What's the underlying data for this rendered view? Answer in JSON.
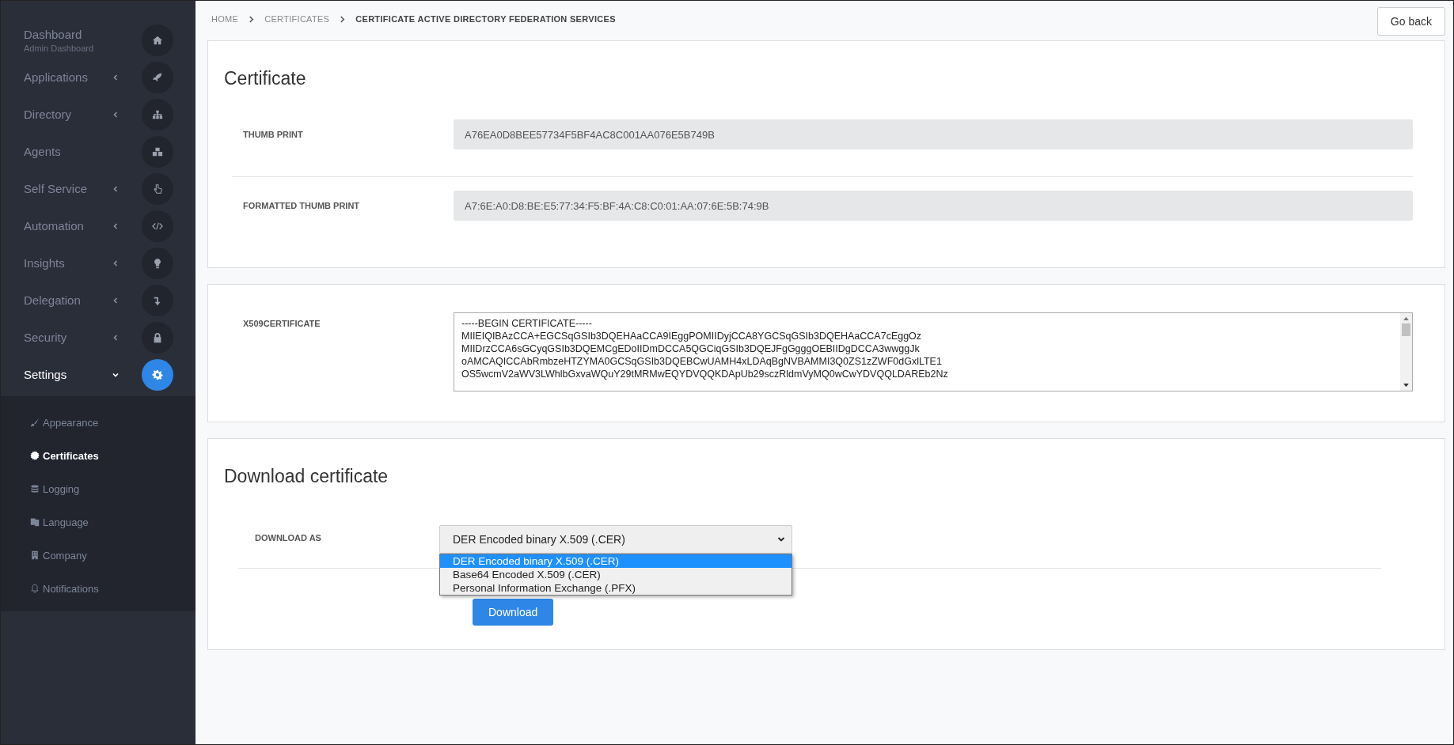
{
  "sidebar": {
    "items": [
      {
        "label": "Dashboard",
        "subtitle": "Admin Dashboard",
        "selected": false
      },
      {
        "label": "Applications",
        "expanded": false,
        "selected": false
      },
      {
        "label": "Directory",
        "expanded": false,
        "selected": false
      },
      {
        "label": "Agents",
        "selected": false
      },
      {
        "label": "Self Service",
        "expanded": false,
        "selected": false
      },
      {
        "label": "Automation",
        "expanded": false,
        "selected": false
      },
      {
        "label": "Insights",
        "expanded": false,
        "selected": false
      },
      {
        "label": "Delegation",
        "expanded": false,
        "selected": false
      },
      {
        "label": "Security",
        "expanded": false,
        "selected": false
      },
      {
        "label": "Settings",
        "expanded": true,
        "selected": true,
        "children": [
          {
            "label": "Appearance",
            "selected": false
          },
          {
            "label": "Certificates",
            "selected": true
          },
          {
            "label": "Logging",
            "selected": false
          },
          {
            "label": "Language",
            "selected": false
          },
          {
            "label": "Company",
            "selected": false
          },
          {
            "label": "Notifications",
            "selected": false
          }
        ]
      }
    ]
  },
  "breadcrumb": [
    {
      "label": "HOME",
      "current": false
    },
    {
      "label": "CERTIFICATES",
      "current": false
    },
    {
      "label": "CERTIFICATE ACTIVE DIRECTORY FEDERATION SERVICES",
      "current": true
    }
  ],
  "go_back_button": "Go back",
  "certificate_card": {
    "title": "Certificate",
    "fields": [
      {
        "label": "THUMB PRINT",
        "value": "A76EA0D8BEE57734F5BF4AC8C001AA076E5B749B"
      },
      {
        "label": "FORMATTED THUMB PRINT",
        "value": "A7:6E:A0:D8:BE:E5:77:34:F5:BF:4A:C8:C0:01:AA:07:6E:5B:74:9B"
      }
    ]
  },
  "x509_card": {
    "label": "X509CERTIFICATE",
    "lines": [
      "-----BEGIN CERTIFICATE-----",
      "MIIEIQIBAzCCA+EGCSqGSIb3DQEHAaCCA9IEggPOMIIDyjCCA8YGCSqGSIb3DQEHAaCCA7cEggOz",
      "MIIDrzCCA6sGCyqGSIb3DQEMCgEDoIIDmDCCA5QGCiqGSIb3DQEJFgGgggOEBIIDgDCCA3wwggJk",
      "oAMCAQICCAbRmbzeHTZYMA0GCSqGSIb3DQEBCwUAMH4xLDAqBgNVBAMMI3Q0ZS1zZWF0dGxlLTE1",
      "OS5wcmV2aWV3LWhlbGxvaWQuY29tMRMwEQYDVQQKDApUb29sczRldmVyMQ0wCwYDVQQLDAREb2Nz"
    ]
  },
  "download_card": {
    "title": "Download certificate",
    "label": "DOWNLOAD AS",
    "select_value": "DER Encoded binary X.509 (.CER)",
    "options": [
      {
        "label": "DER Encoded binary X.509 (.CER)",
        "selected": true
      },
      {
        "label": "Base64 Encoded X.509 (.CER)",
        "selected": false
      },
      {
        "label": "Personal Information Exchange (.PFX)",
        "selected": false
      }
    ],
    "button": "Download"
  }
}
